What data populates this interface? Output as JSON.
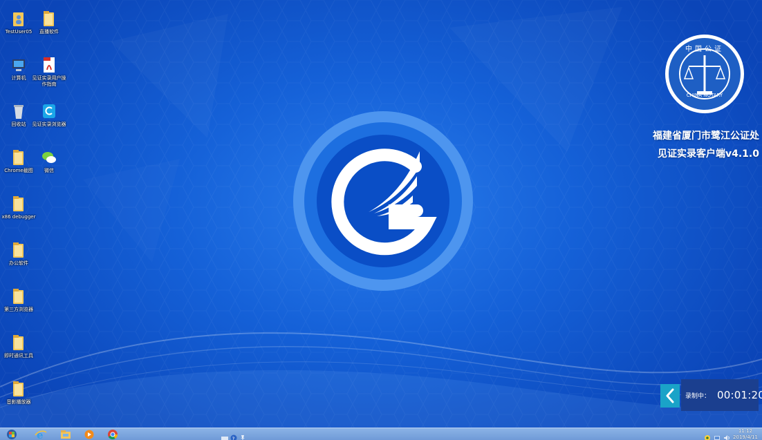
{
  "desktop": {
    "icons": [
      {
        "label": "TestUser05",
        "icon": "user-folder-icon"
      },
      {
        "label": "直播软件",
        "icon": "folder-icon"
      },
      {
        "label": "计算机",
        "icon": "computer-icon"
      },
      {
        "label": "见证实录用户操作指南",
        "icon": "pdf-icon"
      },
      {
        "label": "回收站",
        "icon": "recycle-bin-icon"
      },
      {
        "label": "见证实录浏览器",
        "icon": "browser-app-icon"
      },
      {
        "label": "Chrome截图",
        "icon": "folder-icon"
      },
      {
        "label": "微信",
        "icon": "wechat-icon"
      },
      {
        "label": "x86 debugger",
        "icon": "folder-icon"
      },
      {
        "label": "办公软件",
        "icon": "folder-icon"
      },
      {
        "label": "第三方浏览器",
        "icon": "folder-icon"
      },
      {
        "label": "即时通讯工具",
        "icon": "folder-icon"
      },
      {
        "label": "音影播放器",
        "icon": "folder-icon"
      }
    ]
  },
  "brand": {
    "seal_text": "CHINA NOTARY",
    "seal_top_text": "中国公证",
    "org": "福建省厦门市鹭江公证处",
    "app": "见证实录客户端v4.1.0"
  },
  "recording": {
    "label": "录制中：",
    "time": "00:01:20"
  },
  "taskbar": {
    "items": [
      "start-orb-icon",
      "ie-icon",
      "explorer-icon",
      "media-player-icon",
      "chrome-icon"
    ],
    "clock_time": "11:12",
    "clock_date": "2019/4/11"
  },
  "colors": {
    "desktop_blue": "#1561d8",
    "recording_panel": "#1b3f8f",
    "toggle_cyan": "#1aa3c8"
  }
}
